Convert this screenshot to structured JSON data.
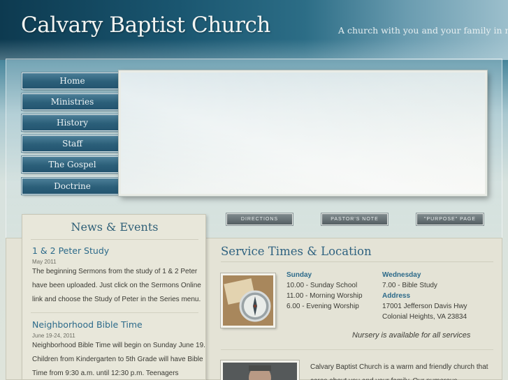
{
  "header": {
    "title": "Calvary Baptist Church",
    "tagline": "A church with you and your family in mind"
  },
  "nav": {
    "items": [
      {
        "label": "Home"
      },
      {
        "label": "Ministries"
      },
      {
        "label": "History"
      },
      {
        "label": "Staff"
      },
      {
        "label": "The Gospel"
      },
      {
        "label": "Doctrine"
      }
    ]
  },
  "buttons": {
    "directions": "DIRECTIONS",
    "pastors_note": "PASTOR'S NOTE",
    "purpose_page": "\"PURPOSE\" PAGE"
  },
  "news": {
    "title": "News & Events",
    "items": [
      {
        "title": "1 & 2 Peter Study",
        "date": "May 2011",
        "body": "The beginning Sermons from the study of 1 & 2 Peter have been uploaded. Just click on the Sermons Online link and choose the Study of Peter in the Series menu."
      },
      {
        "title": "Neighborhood Bible Time",
        "date": "June 19-24, 2011",
        "body": "Neighborhood Bible Time will begin on Sunday June 19. Children from Kindergarten to 5th Grade will have Bible Time from 9:30 a.m. until 12:30 p.m. Teenagers"
      }
    ]
  },
  "service": {
    "title": "Service Times & Location",
    "sunday": {
      "heading": "Sunday",
      "lines": [
        "10.00 - Sunday School",
        "11.00 - Morning Worship",
        "6.00 - Evening Worship"
      ]
    },
    "wednesday": {
      "heading": "Wednesday",
      "lines": [
        "7.00 - Bible Study"
      ]
    },
    "address": {
      "heading": "Address",
      "lines": [
        "17001 Jefferson Davis Hwy",
        "Colonial Heights, VA 23834"
      ]
    },
    "nursery": "Nursery is available for all services"
  },
  "welcome": {
    "text": "Calvary Baptist Church is a warm and friendly church that cares about you and your family. Our numerous"
  },
  "colors": {
    "accent": "#2c6a8a",
    "nav_button": "#2b5f79",
    "panel": "#e4e3d6"
  },
  "icons": {
    "service_image": "compass-and-map-image",
    "welcome_image": "pastor-photo"
  }
}
